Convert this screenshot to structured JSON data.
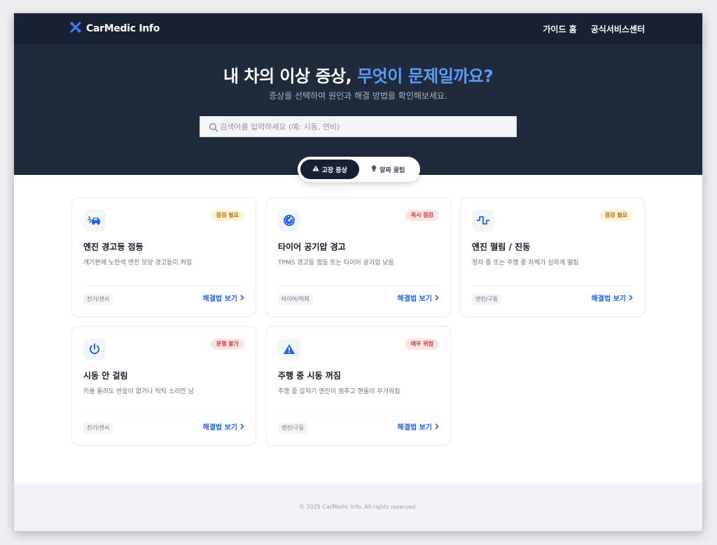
{
  "brand": {
    "name": "CarMedic Info",
    "icon": "tools-icon",
    "color": "#3b82f6"
  },
  "nav": {
    "items": [
      "가이드 홈",
      "공식서비스센터"
    ]
  },
  "hero": {
    "title_main": "내 차의 이상 증상, ",
    "title_accent": "무엇이 문제일까요?",
    "subtitle": "증상을 선택하여 원인과 해결 방법을 확인해보세요.",
    "accent_color": "#5b9cf8"
  },
  "search": {
    "placeholder": "검색어를 입력하세요 (예: 시동, 연비)",
    "value": "",
    "icon": "search-icon"
  },
  "tabs": [
    {
      "label": "고장 증상",
      "icon": "warning-icon",
      "active": true
    },
    {
      "label": "알짜 꿀팁",
      "icon": "lightbulb-icon",
      "active": false
    }
  ],
  "cards": [
    {
      "icon": "car-crash-icon",
      "badge": "점검 필요",
      "badge_color": "yellow",
      "title": "엔진 경고등 점등",
      "description": "계기판에 노란색 엔진 모양 경고등이 켜짐",
      "tag": "전기/센서",
      "link": "해결법 보기"
    },
    {
      "icon": "gauge-icon",
      "badge": "즉시 점검",
      "badge_color": "red",
      "title": "타이어 공기압 경고",
      "description": "TPMS 경고등 점등 또는 타이어 공기압 낮음",
      "tag": "타이어/하체",
      "link": "해결법 보기"
    },
    {
      "icon": "wave-icon",
      "badge": "점검 필요",
      "badge_color": "yellow",
      "title": "엔진 떨림 / 진동",
      "description": "정차 중 또는 주행 중 차체가 심하게 떨림",
      "tag": "엔진/구동",
      "link": "해결법 보기"
    },
    {
      "icon": "power-icon",
      "badge": "운행 불가",
      "badge_color": "red",
      "title": "시동 안 걸림",
      "description": "키를 돌려도 반응이 없거나 틱틱 소리만 남",
      "tag": "전기/센서",
      "link": "해결법 보기"
    },
    {
      "icon": "triangle-warning-icon",
      "badge": "매우 위험",
      "badge_color": "red",
      "title": "주행 중 시동 꺼짐",
      "description": "주행 중 갑자기 엔진이 멈추고 핸들이 무거워짐",
      "tag": "엔진/구동",
      "link": "해결법 보기"
    }
  ],
  "footer": {
    "text": "© 2025 CarMedic Info. All rights reserved."
  }
}
